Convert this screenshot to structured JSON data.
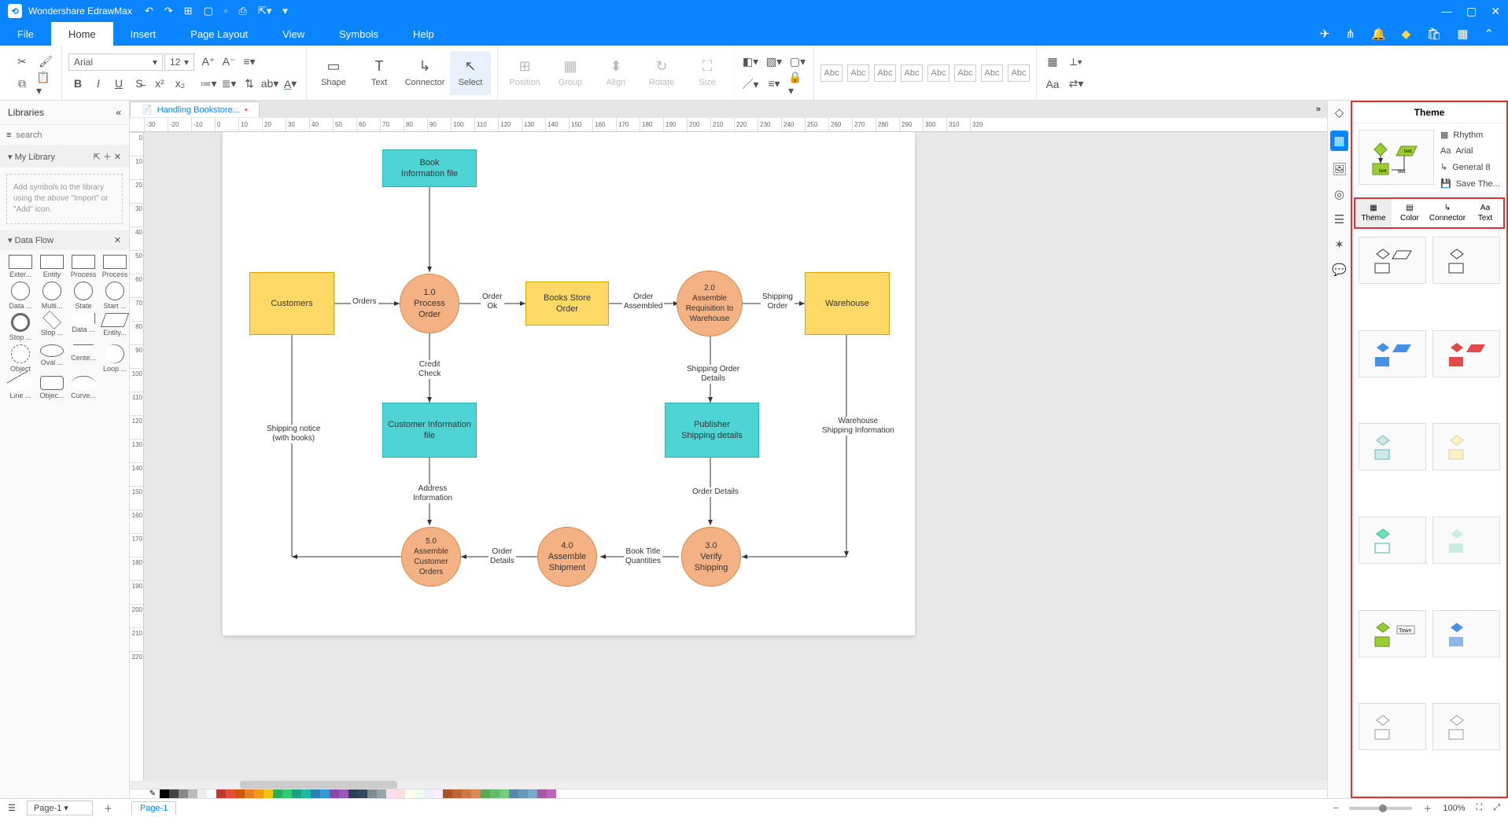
{
  "app": {
    "title": "Wondershare EdrawMax"
  },
  "menu": {
    "tabs": [
      "File",
      "Home",
      "Insert",
      "Page Layout",
      "View",
      "Symbols",
      "Help"
    ],
    "active": 1
  },
  "document": {
    "tab_name": "Handling Bookstore...",
    "dirty": "•",
    "page_name": "Page-1",
    "page_selector": "Page-1"
  },
  "font": {
    "family": "Arial",
    "size": "12"
  },
  "ribbon": {
    "shape": "Shape",
    "text": "Text",
    "connector": "Connector",
    "select": "Select",
    "position": "Position",
    "group": "Group",
    "align": "Align",
    "rotate": "Rotate",
    "size": "Size",
    "swatch_label": "Abc"
  },
  "libraries": {
    "title": "Libraries",
    "search_placeholder": "search",
    "mylib": "My Library",
    "import_hint": "Add symbols to the library using the above \"Import\" or \"Add\" icon.",
    "dataflow": "Data Flow",
    "shapes": [
      "Exter...",
      "Entity",
      "Process",
      "Process",
      "Data ...",
      "Multi...",
      "State",
      "Start ...",
      "Stop ...",
      "Stop ...",
      "Data ...",
      "Entity...",
      "Object",
      "Oval ...",
      "Cente...",
      "Loop ...",
      "Line ...",
      "Objec...",
      "Curve..."
    ]
  },
  "diagram": {
    "nodes": {
      "bookinfo": "Book\nInformation file",
      "customers": "Customers",
      "p1": "1.0\nProcess Order",
      "bso": "Books Store\nOrder",
      "p2": "2.0\nAssemble\nRequisition to\nWarehouse",
      "warehouse": "Warehouse",
      "custinfo": "Customer Information\nfile",
      "pubship": "Publisher\nShipping details",
      "p5": "5.0\nAssemble\nCustomer\nOrders",
      "p4": "4.0\nAssemble\nShipment",
      "p3": "3.0\nVerify\nShipping"
    },
    "edges": {
      "orders": "Orders",
      "orderok": "Order\nOk",
      "orderasm": "Order\nAssembled",
      "shiporder": "Shipping\nOrder",
      "credit": "Credit\nCheck",
      "sod": "Shipping Order\nDetails",
      "shipnotice": "Shipping notice\n(with books)",
      "addrinfo": "Address\nInformation",
      "orderdet": "Order Details",
      "whship": "Warehouse\nShipping Information",
      "btq": "Book Title\nQuantities",
      "odet2": "Order\nDetails"
    }
  },
  "theme": {
    "title": "Theme",
    "rhythm": "Rhythm",
    "font": "Arial",
    "general": "General 8",
    "save": "Save The...",
    "tabs": {
      "theme": "Theme",
      "color": "Color",
      "connector": "Connector",
      "text": "Text"
    },
    "swatch_town": "Town"
  },
  "status": {
    "zoom": "100%"
  },
  "ruler": {
    "h": [
      "-30",
      "-20",
      "-10",
      "0",
      "10",
      "20",
      "30",
      "40",
      "50",
      "60",
      "70",
      "80",
      "90",
      "100",
      "110",
      "120",
      "130",
      "140",
      "150",
      "160",
      "170",
      "180",
      "190",
      "200",
      "210",
      "220",
      "230",
      "240",
      "250",
      "260",
      "270",
      "280",
      "290",
      "300",
      "310",
      "320"
    ],
    "v": [
      "0",
      "10",
      "20",
      "30",
      "40",
      "50",
      "60",
      "70",
      "80",
      "90",
      "100",
      "110",
      "120",
      "130",
      "140",
      "150",
      "160",
      "170",
      "180",
      "190",
      "200",
      "210",
      "220"
    ]
  },
  "colors": [
    "#000",
    "#444",
    "#888",
    "#bbb",
    "#eee",
    "#fff",
    "#c0392b",
    "#e74c3c",
    "#d35400",
    "#e67e22",
    "#f39c12",
    "#f1c40f",
    "#27ae60",
    "#2ecc71",
    "#16a085",
    "#1abc9c",
    "#2980b9",
    "#3498db",
    "#8e44ad",
    "#9b59b6",
    "#2c3e50",
    "#34495e",
    "#7f8c8d",
    "#95a5a6",
    "#fde",
    "#fdd",
    "#ffe",
    "#efe",
    "#eef",
    "#fef",
    "#a52",
    "#b63",
    "#c74",
    "#d85",
    "#5a5",
    "#6b6",
    "#7c7",
    "#58a",
    "#69b",
    "#7ac",
    "#a5a",
    "#b6b"
  ]
}
